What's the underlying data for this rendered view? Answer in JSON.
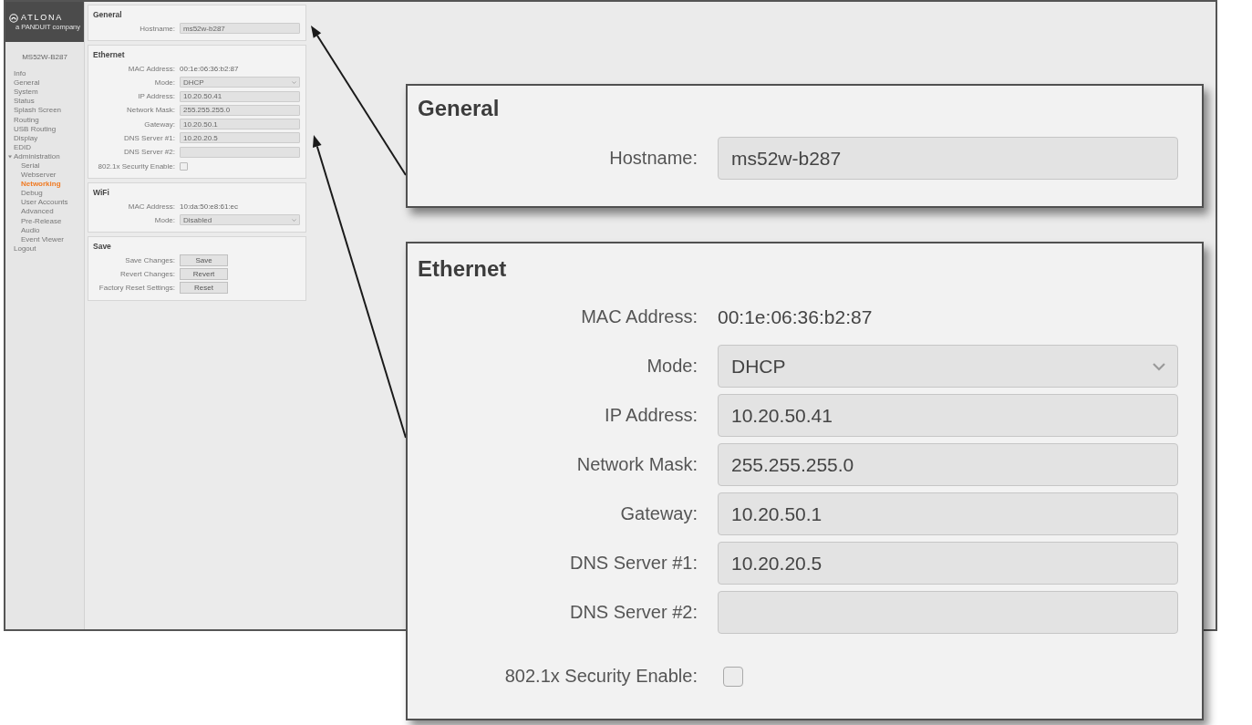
{
  "screenshot": {
    "sidebar": {
      "logo": {
        "name": "ATLONA",
        "tagline": "a PANDUIT company"
      },
      "device_name": "MS52W-B287",
      "items": [
        {
          "label": "Info",
          "selected": false
        },
        {
          "label": "General",
          "selected": false
        },
        {
          "label": "System",
          "selected": false
        },
        {
          "label": "Status",
          "selected": false
        },
        {
          "label": "Splash Screen",
          "selected": false
        },
        {
          "label": "Routing",
          "selected": false
        },
        {
          "label": "USB Routing",
          "selected": false
        },
        {
          "label": "Display",
          "selected": false
        },
        {
          "label": "EDID",
          "selected": false
        },
        {
          "label": "Administration",
          "selected": false,
          "expanded": true,
          "children": [
            {
              "label": "Serial",
              "selected": false
            },
            {
              "label": "Webserver",
              "selected": false
            },
            {
              "label": "Networking",
              "selected": true
            },
            {
              "label": "Debug",
              "selected": false
            },
            {
              "label": "User Accounts",
              "selected": false
            },
            {
              "label": "Advanced",
              "selected": false
            },
            {
              "label": "Pre-Release",
              "selected": false
            },
            {
              "label": "Audio",
              "selected": false
            },
            {
              "label": "Event Viewer",
              "selected": false
            }
          ]
        },
        {
          "label": "Logout",
          "selected": false
        }
      ]
    },
    "panels": [
      {
        "title": "General",
        "rows": [
          {
            "kind": "text",
            "label": "Hostname:",
            "value": "ms52w-b287"
          }
        ]
      },
      {
        "title": "Ethernet",
        "rows": [
          {
            "kind": "static",
            "label": "MAC Address:",
            "value": "00:1e:06:36:b2:87"
          },
          {
            "kind": "select",
            "label": "Mode:",
            "value": "DHCP"
          },
          {
            "kind": "text",
            "label": "IP Address:",
            "value": "10.20.50.41"
          },
          {
            "kind": "text",
            "label": "Network Mask:",
            "value": "255.255.255.0"
          },
          {
            "kind": "text",
            "label": "Gateway:",
            "value": "10.20.50.1"
          },
          {
            "kind": "text",
            "label": "DNS Server #1:",
            "value": "10.20.20.5"
          },
          {
            "kind": "text",
            "label": "DNS Server #2:"
          },
          {
            "kind": "checkbox",
            "label": "802.1x Security Enable:",
            "checked": false
          }
        ]
      },
      {
        "title": "WiFi",
        "rows": [
          {
            "kind": "static",
            "label": "MAC Address:",
            "value": "10:da:50:e8:61:ec"
          },
          {
            "kind": "select",
            "label": "Mode:",
            "value": "Disabled"
          }
        ]
      },
      {
        "title": "Save",
        "rows": [
          {
            "kind": "button",
            "label": "Save Changes:",
            "button": "Save"
          },
          {
            "kind": "button",
            "label": "Revert Changes:",
            "button": "Revert"
          },
          {
            "kind": "button",
            "label": "Factory Reset Settings:",
            "button": "Reset"
          }
        ]
      }
    ]
  },
  "callouts": [
    {
      "title": "General",
      "rows": [
        {
          "kind": "text",
          "label": "Hostname:",
          "value": "ms52w-b287"
        }
      ]
    },
    {
      "title": "Ethernet",
      "rows": [
        {
          "kind": "static",
          "label": "MAC Address:",
          "value": "00:1e:06:36:b2:87"
        },
        {
          "kind": "select",
          "label": "Mode:",
          "value": "DHCP"
        },
        {
          "kind": "text",
          "label": "IP Address:",
          "value": "10.20.50.41"
        },
        {
          "kind": "text",
          "label": "Network Mask:",
          "value": "255.255.255.0"
        },
        {
          "kind": "text",
          "label": "Gateway:",
          "value": "10.20.50.1"
        },
        {
          "kind": "text",
          "label": "DNS Server #1:",
          "value": "10.20.20.5"
        },
        {
          "kind": "text",
          "label": "DNS Server #2:"
        },
        {
          "kind": "checkbox",
          "label": "802.1x Security Enable:",
          "checked": false
        }
      ]
    }
  ]
}
